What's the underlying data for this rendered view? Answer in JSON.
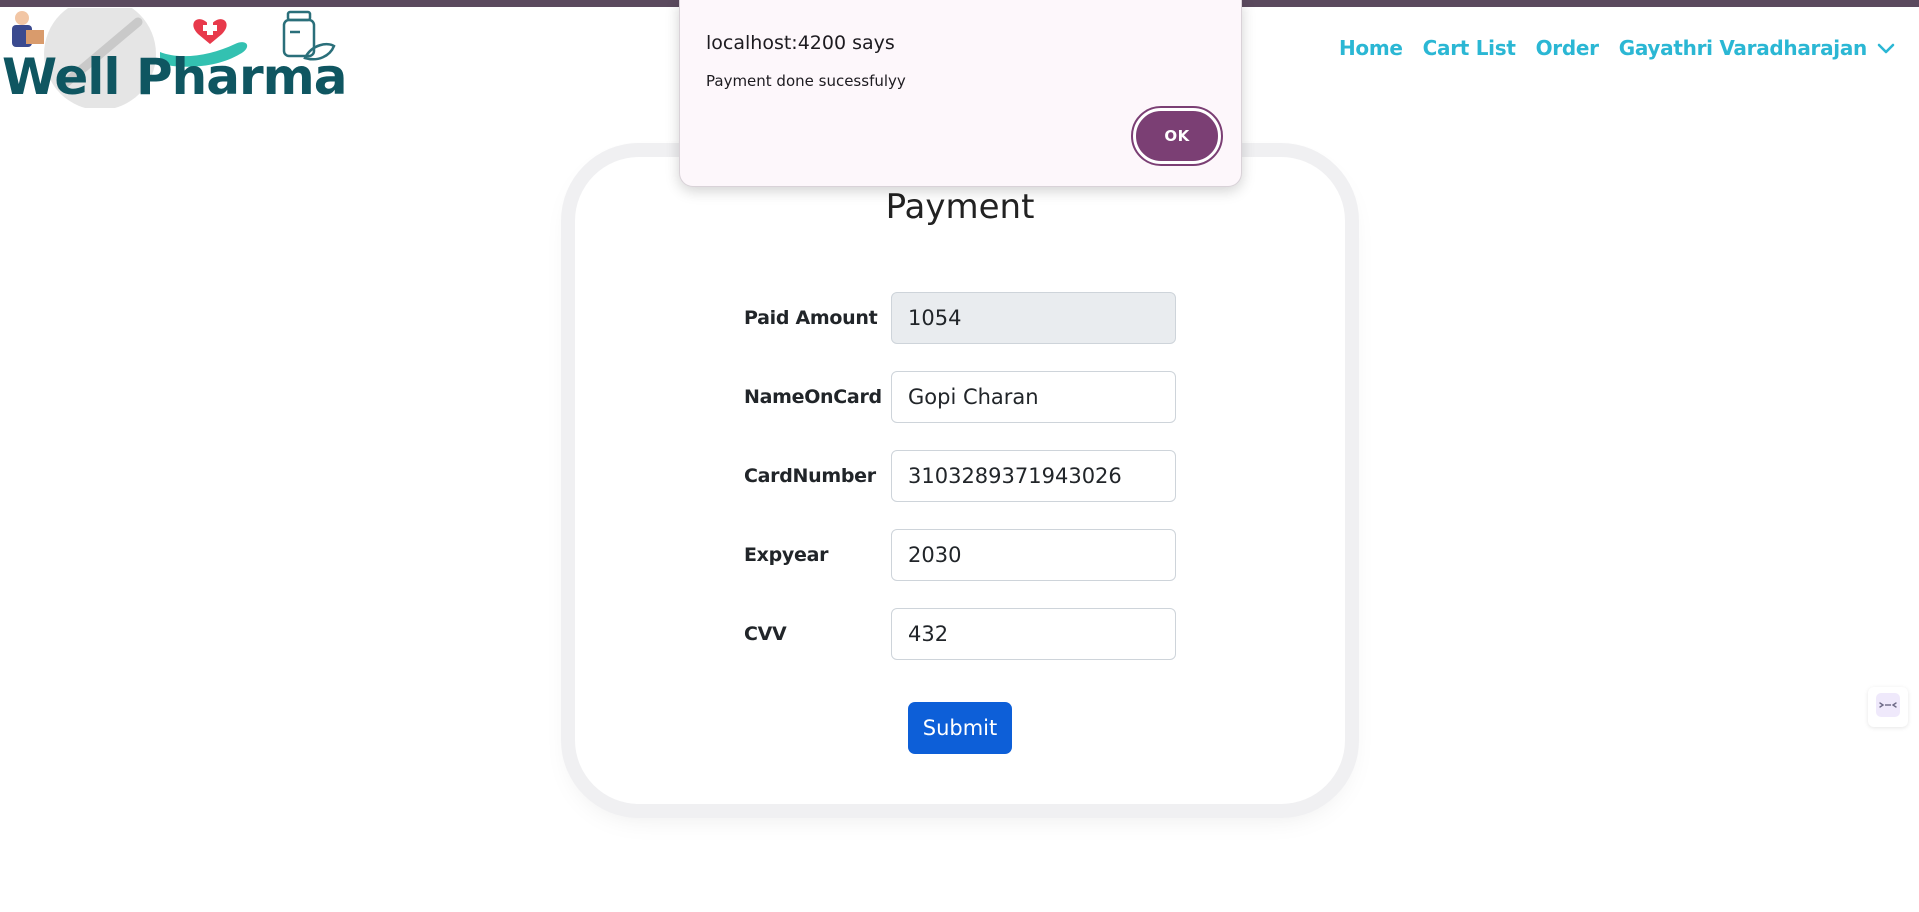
{
  "brand": {
    "logo_text": "Well Pharma"
  },
  "nav": {
    "home": "Home",
    "cart_list": "Cart List",
    "order": "Order",
    "user_name": "Gayathri Varadharajan"
  },
  "payment": {
    "title": "Payment",
    "fields": [
      {
        "label": "Paid Amount",
        "value": "1054",
        "readonly": true
      },
      {
        "label": "NameOnCard",
        "value": "Gopi Charan",
        "readonly": false
      },
      {
        "label": "CardNumber",
        "value": "3103289371943026",
        "readonly": false
      },
      {
        "label": "Expyear",
        "value": "2030",
        "readonly": false
      },
      {
        "label": "CVV",
        "value": "432",
        "readonly": false
      }
    ],
    "submit_label": "Submit"
  },
  "dialog": {
    "title": "localhost:4200 says",
    "message": "Payment done sucessfulyy",
    "ok_label": "OK"
  },
  "colors": {
    "nav_link": "#2bb7d4",
    "logo_text": "#0f5661",
    "submit_button": "#0d5fd8",
    "ok_button": "#7b3f74",
    "dialog_bg": "#fdf7fb"
  },
  "icons": {
    "user_menu": "chevron-down-icon",
    "side_widget": "extension-icon"
  }
}
